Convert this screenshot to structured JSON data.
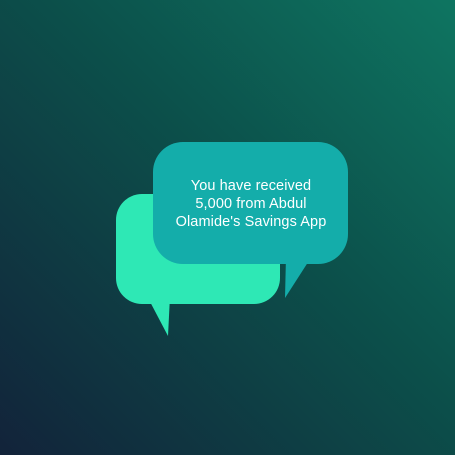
{
  "notification": {
    "message_lines": [
      "You have received",
      "5,000 from Abdul",
      "Olamide's Savings App"
    ]
  },
  "colors": {
    "background_top_right": "#0e7561",
    "background_bottom_left": "#12233a",
    "back_bubble": "#2ee8b5",
    "front_bubble": "#14adaa",
    "text": "#ffffff"
  },
  "icons": {
    "back_bubble": "speech-bubble-icon",
    "front_bubble": "speech-bubble-icon"
  }
}
